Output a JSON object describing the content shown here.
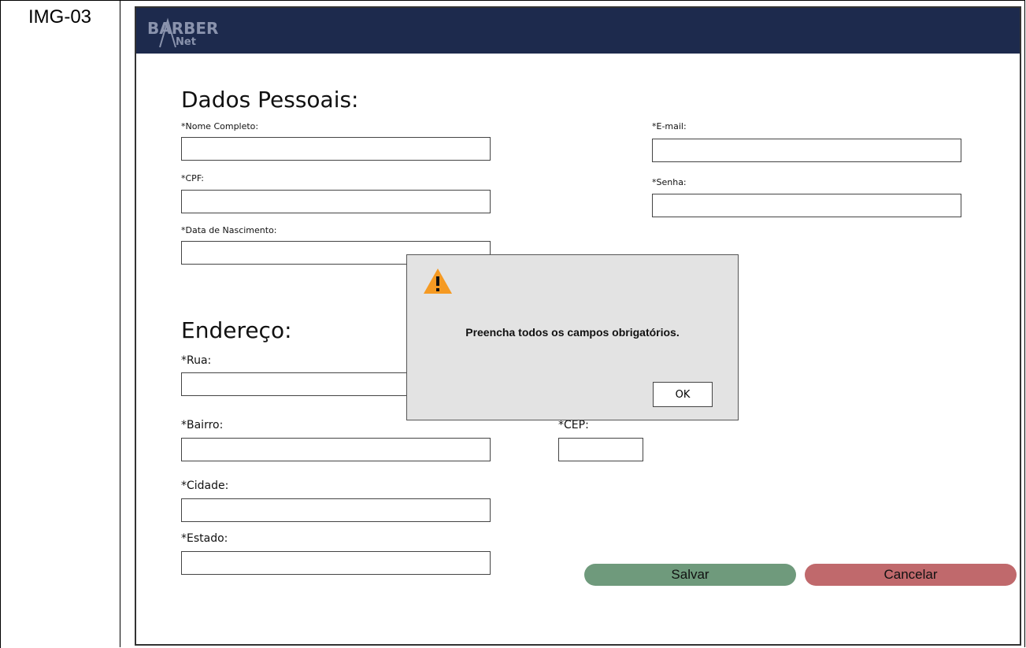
{
  "doc": {
    "image_label": "IMG-03"
  },
  "header": {
    "logo_text": "BARBER",
    "logo_subtext": "Net",
    "bg_color": "#1d2a4d"
  },
  "personal": {
    "title": "Dados Pessoais:",
    "full_name_label": "*Nome Completo:",
    "cpf_label": "*CPF:",
    "birth_date_label": "*Data de Nascimento:",
    "email_label": "*E-mail:",
    "password_label": "*Senha:"
  },
  "address": {
    "title": "Endereço:",
    "street_label": "*Rua:",
    "neighborhood_label": "*Bairro:",
    "zip_label": "*CEP:",
    "city_label": "*Cidade:",
    "state_label": "*Estado:"
  },
  "actions": {
    "save_label": "Salvar",
    "save_color": "#6f9a7c",
    "cancel_label": "Cancelar",
    "cancel_color": "#c0696c"
  },
  "dialog": {
    "icon": "warning-icon",
    "message": "Preencha todos os campos obrigatórios.",
    "ok_label": "OK",
    "icon_color": "#f59a23"
  }
}
